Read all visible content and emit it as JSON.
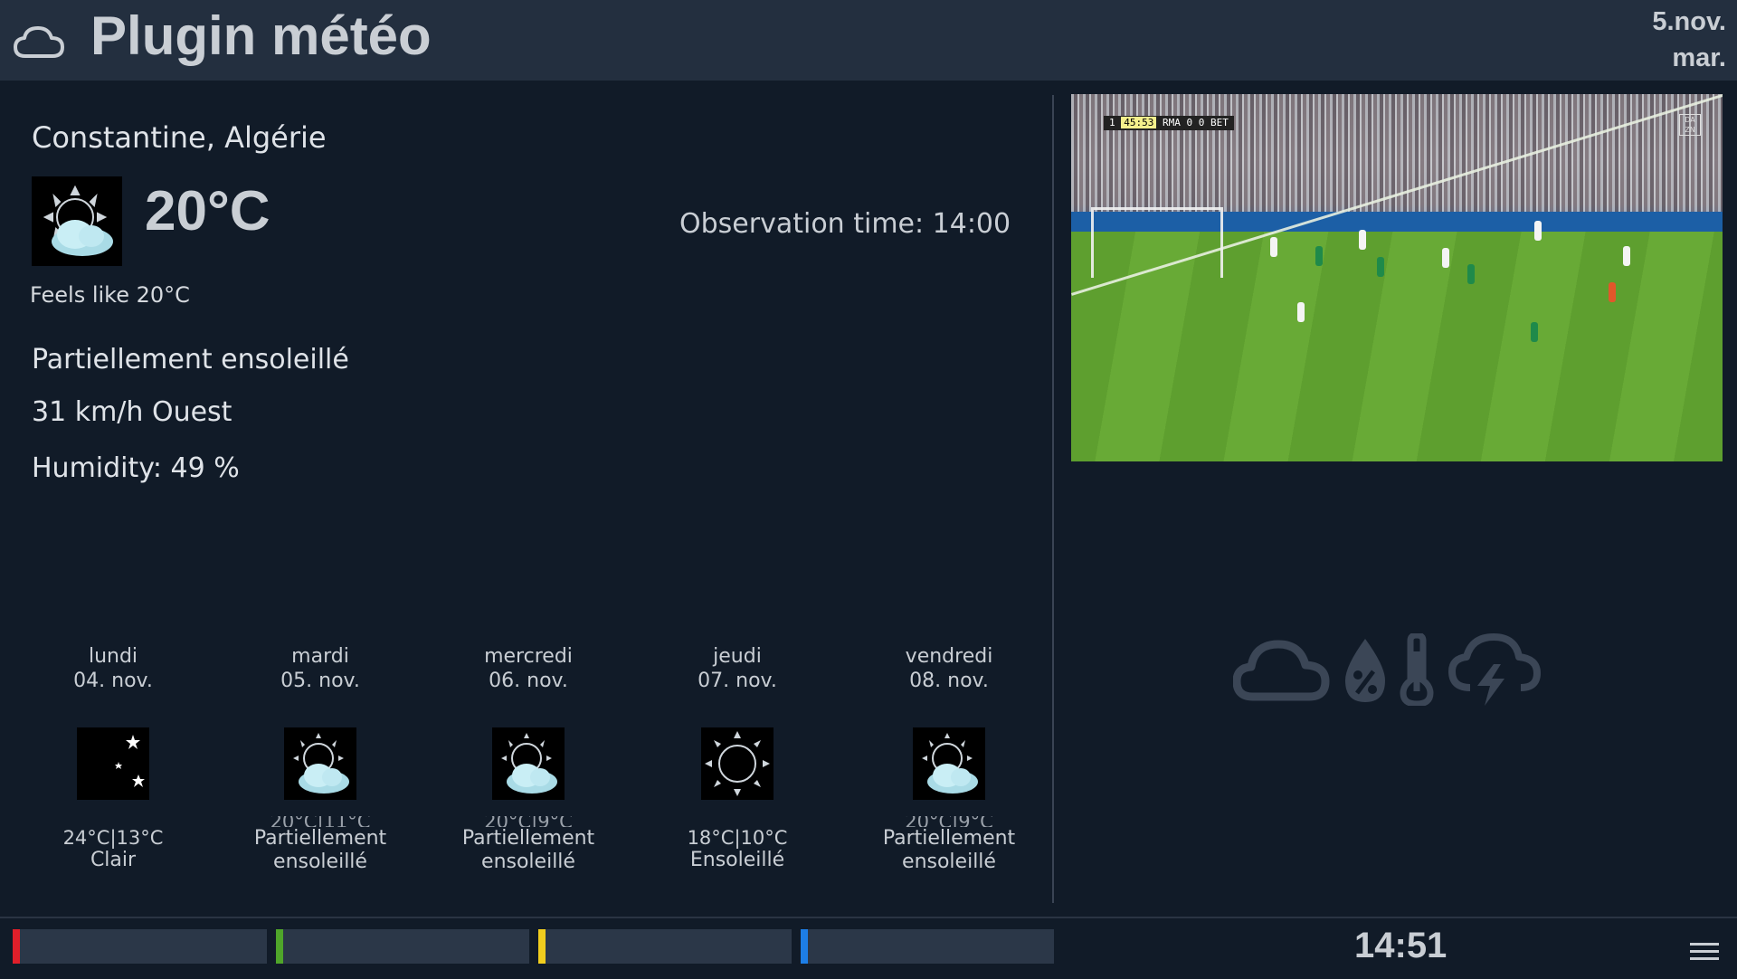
{
  "header": {
    "title": "Plugin météo",
    "date_line1": "5.nov.",
    "date_line2": "mar.",
    "icon": "cloud-icon"
  },
  "current": {
    "location": "Constantine, Algérie",
    "temperature": "20°C",
    "observation": "Observation time: 14:00",
    "feels_like": "Feels like 20°C",
    "condition": "Partiellement ensoleillé",
    "wind": "31 km/h Ouest",
    "humidity": "Humidity: 49 %",
    "icon": "partly-sunny-icon"
  },
  "forecast": [
    {
      "day": "lundi",
      "date": "04. nov.",
      "temps": "24°C|13°C",
      "condition": "Clair",
      "icon": "moon-stars-icon"
    },
    {
      "day": "mardi",
      "date": "05. nov.",
      "temps": "20°C|11°C",
      "condition": "Partiellement ensoleillé",
      "icon": "partly-sunny-icon"
    },
    {
      "day": "mercredi",
      "date": "06. nov.",
      "temps": "20°C|9°C",
      "condition": "Partiellement ensoleillé",
      "icon": "partly-sunny-icon"
    },
    {
      "day": "jeudi",
      "date": "07. nov.",
      "temps": "18°C|10°C",
      "condition": "Ensoleillé",
      "icon": "sun-icon"
    },
    {
      "day": "vendredi",
      "date": "08. nov.",
      "temps": "20°C|9°C",
      "condition": "Partiellement ensoleillé",
      "icon": "partly-sunny-icon"
    }
  ],
  "video": {
    "score_time": "45:53",
    "score_home": "RMA",
    "score_away": "BET",
    "score_value": "0 0",
    "period": "1",
    "channel_logo": "DA ZN"
  },
  "status_icons": [
    "cloud-icon",
    "humidity-drop-icon",
    "thermometer-icon",
    "storm-cloud-icon"
  ],
  "footer": {
    "clock": "14:51",
    "color_buttons": [
      {
        "name": "red",
        "color": "#e01f2a"
      },
      {
        "name": "green",
        "color": "#4fa52a"
      },
      {
        "name": "yellow",
        "color": "#f1cd1e"
      },
      {
        "name": "blue",
        "color": "#1d7ee6"
      }
    ]
  }
}
